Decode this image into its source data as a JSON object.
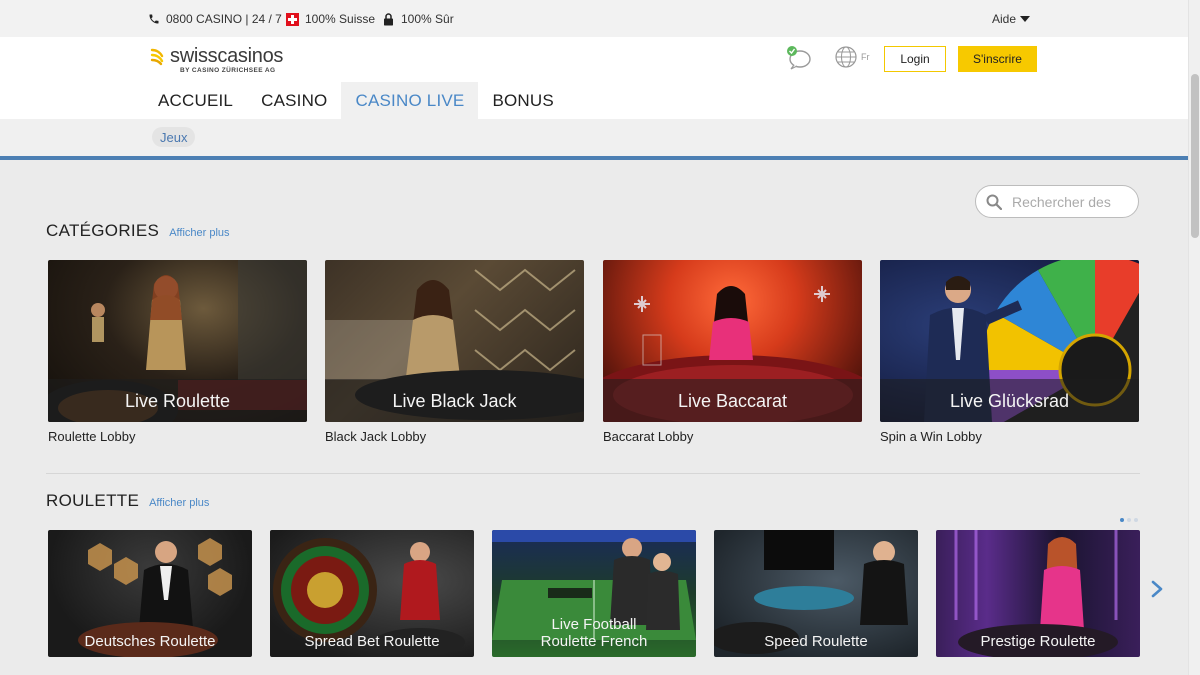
{
  "topbar": {
    "phone": "0800 CASINO | 24 / 7",
    "swiss": "100% Suisse",
    "secure": "100% Sûr",
    "help": "Aide"
  },
  "header": {
    "logo_main": "swisscasinos",
    "logo_sub": "BY CASINO ZÜRICHSEE AG",
    "language": "Fr",
    "login": "Login",
    "signup": "S'inscrire"
  },
  "nav": {
    "items": [
      {
        "label": "ACCUEIL"
      },
      {
        "label": "CASINO"
      },
      {
        "label": "CASINO LIVE",
        "active": true
      },
      {
        "label": "BONUS"
      }
    ]
  },
  "subnav": {
    "chip": "Jeux"
  },
  "search": {
    "placeholder": "Rechercher des"
  },
  "categories": {
    "title": "CATÉGORIES",
    "more": "Afficher plus",
    "cards": [
      {
        "overlay": "Live Roulette",
        "label": "Roulette Lobby"
      },
      {
        "overlay": "Live Black Jack",
        "label": "Black Jack Lobby"
      },
      {
        "overlay": "Live Baccarat",
        "label": "Baccarat Lobby"
      },
      {
        "overlay": "Live Glücksrad",
        "label": "Spin a Win Lobby"
      }
    ]
  },
  "roulette": {
    "title": "ROULETTE",
    "more": "Afficher plus",
    "cards": [
      {
        "line1": "Deutsches Roulette",
        "line2": ""
      },
      {
        "line1": "Spread Bet Roulette",
        "line2": ""
      },
      {
        "line1": "Live Football",
        "line2": "Roulette French"
      },
      {
        "line1": "Speed Roulette",
        "line2": ""
      },
      {
        "line1": "Prestige Roulette",
        "line2": ""
      }
    ]
  },
  "colors": {
    "accent_blue": "#4a88c7",
    "brand_yellow": "#f7c900",
    "rule_blue": "#4c7fb3"
  },
  "icons": [
    "phone-icon",
    "swiss-flag-icon",
    "lock-icon",
    "chevron-down-icon",
    "chat-icon",
    "globe-icon",
    "search-icon",
    "chevron-right-icon"
  ]
}
